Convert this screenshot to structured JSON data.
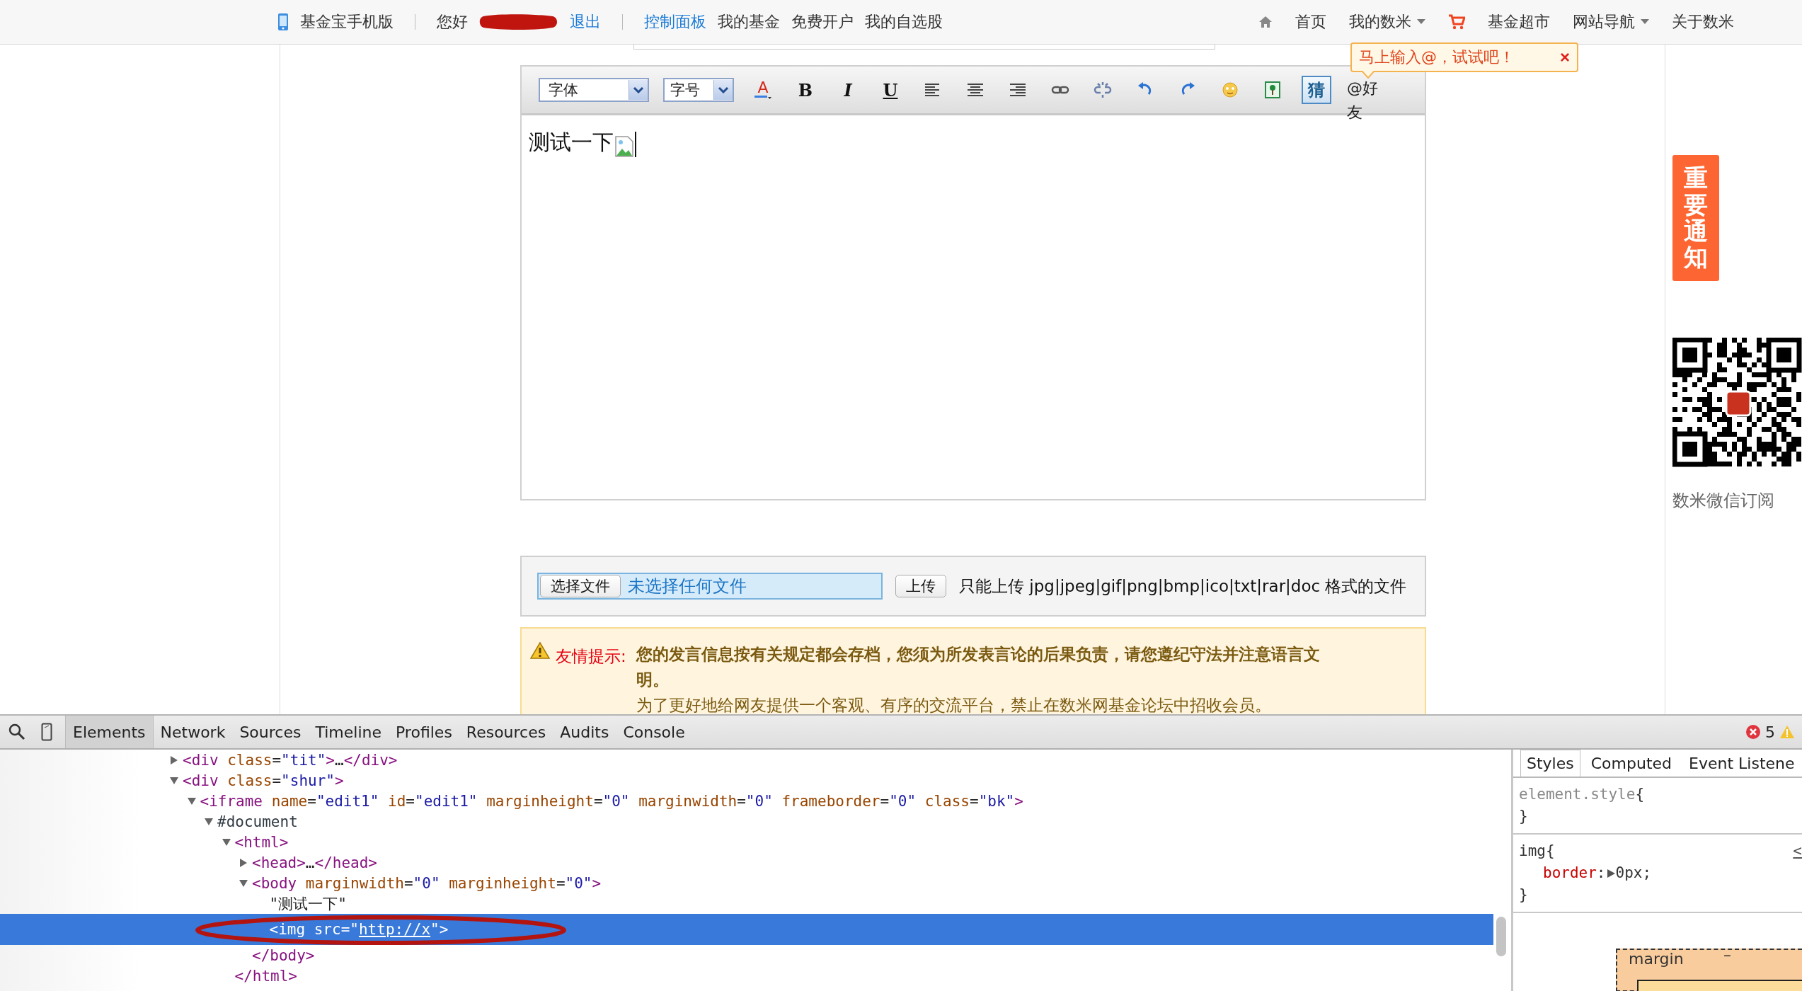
{
  "top_nav": {
    "left": [
      {
        "kind": "app",
        "label": "基金宝手机版"
      },
      {
        "kind": "divider"
      },
      {
        "kind": "text",
        "label": "您好"
      },
      {
        "kind": "redacted"
      },
      {
        "kind": "link",
        "label": "退出"
      },
      {
        "kind": "divider"
      },
      {
        "kind": "link",
        "label": "控制面板"
      },
      {
        "kind": "item",
        "label": "我的基金"
      },
      {
        "kind": "item",
        "label": "免费开户"
      },
      {
        "kind": "item",
        "label": "我的自选股"
      }
    ],
    "right": [
      {
        "kind": "home",
        "label": "首页"
      },
      {
        "kind": "dropdown",
        "label": "我的数米"
      },
      {
        "kind": "cart",
        "label": "基金超市"
      },
      {
        "kind": "dropdown",
        "label": "网站导航"
      },
      {
        "kind": "item",
        "label": "关于数米"
      }
    ]
  },
  "tooltip": {
    "text": "马上输入@，试试吧！",
    "close": "×"
  },
  "editor": {
    "toolbar": [
      {
        "kind": "select",
        "label": "字体"
      },
      {
        "kind": "select",
        "label": "字号"
      },
      {
        "kind": "color",
        "label": "A"
      },
      {
        "kind": "bold",
        "label": "B"
      },
      {
        "kind": "italic",
        "label": "I"
      },
      {
        "kind": "underline",
        "label": "U"
      },
      {
        "kind": "align-left"
      },
      {
        "kind": "align-center"
      },
      {
        "kind": "align-right"
      },
      {
        "kind": "link"
      },
      {
        "kind": "unlink"
      },
      {
        "kind": "undo"
      },
      {
        "kind": "redo"
      },
      {
        "kind": "emoticon"
      },
      {
        "kind": "image"
      },
      {
        "kind": "guess",
        "label": "猜"
      },
      {
        "kind": "mention",
        "label": "@好友"
      }
    ],
    "content": "测试一下",
    "broken_image": true
  },
  "upload": {
    "choose_button": "选择文件",
    "file_status": "未选择任何文件",
    "upload_button": "上传",
    "hint": "只能上传 jpg|jpeg|gif|png|bmp|ico|txt|rar|doc 格式的文件"
  },
  "notice": {
    "title": "友情提示:",
    "lines": [
      {
        "text": "您的发言信息按有关规定都会存档，您须为所发表言论的后果负责，请您遵纪守法并注意语言文明。",
        "bold": true
      },
      {
        "text": "为了更好地给网友提供一个客观、有序的交流平台，禁止在数米网基金论坛中招收会员。",
        "bold": false
      }
    ]
  },
  "side": {
    "notice_tab": "重要通知",
    "qr_caption": "数米微信订阅"
  },
  "devtools": {
    "tabs": [
      {
        "label": "Elements",
        "selected": true
      },
      {
        "label": "Network",
        "selected": false
      },
      {
        "label": "Sources",
        "selected": false
      },
      {
        "label": "Timeline",
        "selected": false
      },
      {
        "label": "Profiles",
        "selected": false
      },
      {
        "label": "Resources",
        "selected": false
      },
      {
        "label": "Audits",
        "selected": false
      },
      {
        "label": "Console",
        "selected": false
      }
    ],
    "errors": "5",
    "dom_tree": [
      {
        "expanded": false,
        "selected": false,
        "tokens": [
          {
            "kind": "tag",
            "text": "<div"
          },
          {
            "kind": "attr",
            "text": " class"
          },
          {
            "kind": "punct",
            "text": "="
          },
          {
            "kind": "value",
            "text": "\"tit\""
          },
          {
            "kind": "tag",
            "text": ">"
          },
          {
            "kind": "punct",
            "text": "…"
          },
          {
            "kind": "tag",
            "text": "</div>"
          }
        ]
      },
      {
        "expanded": true,
        "selected": false,
        "tokens": [
          {
            "kind": "tag",
            "text": "<div"
          },
          {
            "kind": "attr",
            "text": " class"
          },
          {
            "kind": "punct",
            "text": "="
          },
          {
            "kind": "value",
            "text": "\"shur\""
          },
          {
            "kind": "tag",
            "text": ">"
          }
        ],
        "children": [
          {
            "expanded": true,
            "selected": false,
            "tokens": [
              {
                "kind": "tag",
                "text": "<iframe"
              },
              {
                "kind": "attr",
                "text": " name"
              },
              {
                "kind": "punct",
                "text": "="
              },
              {
                "kind": "value",
                "text": "\"edit1\""
              },
              {
                "kind": "attr",
                "text": " id"
              },
              {
                "kind": "punct",
                "text": "="
              },
              {
                "kind": "value",
                "text": "\"edit1\""
              },
              {
                "kind": "attr",
                "text": " marginheight"
              },
              {
                "kind": "punct",
                "text": "="
              },
              {
                "kind": "value",
                "text": "\"0\""
              },
              {
                "kind": "attr",
                "text": " marginwidth"
              },
              {
                "kind": "punct",
                "text": "="
              },
              {
                "kind": "value",
                "text": "\"0\""
              },
              {
                "kind": "attr",
                "text": " frameborder"
              },
              {
                "kind": "punct",
                "text": "="
              },
              {
                "kind": "value",
                "text": "\"0\""
              },
              {
                "kind": "attr",
                "text": " class"
              },
              {
                "kind": "punct",
                "text": "="
              },
              {
                "kind": "value",
                "text": "\"bk\""
              },
              {
                "kind": "tag",
                "text": ">"
              }
            ],
            "children": [
              {
                "expanded": true,
                "selected": false,
                "tokens": [
                  {
                    "kind": "node",
                    "text": "#document"
                  }
                ],
                "children": [
                  {
                    "expanded": true,
                    "selected": false,
                    "tokens": [
                      {
                        "kind": "tag",
                        "text": "<html>"
                      }
                    ],
                    "closing": "</html>",
                    "children": [
                      {
                        "expanded": false,
                        "selected": false,
                        "tokens": [
                          {
                            "kind": "tag",
                            "text": "<head>"
                          },
                          {
                            "kind": "punct",
                            "text": "…"
                          },
                          {
                            "kind": "tag",
                            "text": "</head>"
                          }
                        ]
                      },
                      {
                        "expanded": true,
                        "selected": false,
                        "tokens": [
                          {
                            "kind": "tag",
                            "text": "<body"
                          },
                          {
                            "kind": "attr",
                            "text": " marginwidth"
                          },
                          {
                            "kind": "punct",
                            "text": "="
                          },
                          {
                            "kind": "value",
                            "text": "\"0\""
                          },
                          {
                            "kind": "attr",
                            "text": " marginheight"
                          },
                          {
                            "kind": "punct",
                            "text": "="
                          },
                          {
                            "kind": "value",
                            "text": "\"0\""
                          },
                          {
                            "kind": "tag",
                            "text": ">"
                          }
                        ],
                        "closing": "</body>",
                        "children": [
                          {
                            "selected": false,
                            "tokens": [
                              {
                                "kind": "punct",
                                "text": "\"测试一下\""
                              }
                            ]
                          },
                          {
                            "selected": true,
                            "tokens": [
                              {
                                "kind": "tag",
                                "text": "<img"
                              },
                              {
                                "kind": "attr",
                                "text": " src"
                              },
                              {
                                "kind": "punct",
                                "text": "=\""
                              },
                              {
                                "kind": "url",
                                "text": "http://x"
                              },
                              {
                                "kind": "punct",
                                "text": "\""
                              },
                              {
                                "kind": "tag",
                                "text": ">"
                              }
                            ]
                          }
                        ]
                      }
                    ]
                  }
                ]
              }
            ]
          }
        ]
      }
    ],
    "sidebar_tabs": [
      {
        "label": "Styles",
        "selected": true
      },
      {
        "label": "Computed",
        "selected": false
      },
      {
        "label": "Event Listene",
        "selected": false
      }
    ],
    "rules": [
      {
        "kind": "inline",
        "selector": "element.style",
        "open": "{",
        "close": "}"
      },
      {
        "kind": "rule",
        "selector": "img",
        "open": "{",
        "close": "}",
        "source": "<",
        "declarations": [
          {
            "property": "border",
            "colon": ":",
            "value": "0px;",
            "expanded": false
          }
        ]
      }
    ],
    "box_model": {
      "label": "margin",
      "value": "–"
    }
  }
}
